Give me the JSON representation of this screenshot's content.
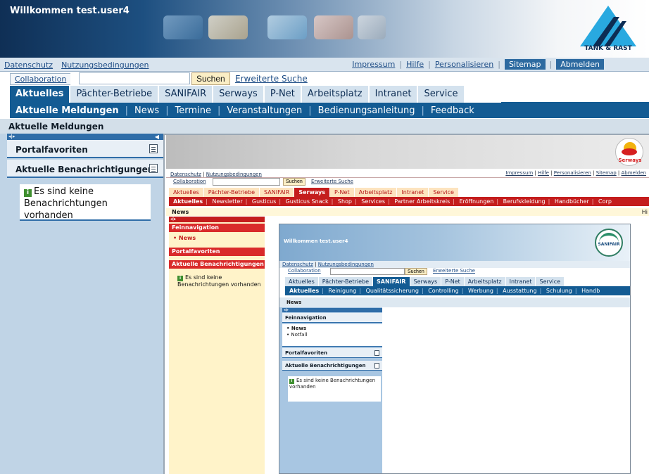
{
  "portal": {
    "welcome": "Willkommen test.user4",
    "logo_text": "TANK & RAST",
    "utility_left": [
      "Datenschutz",
      "Nutzungsbedingungen"
    ],
    "utility_right": [
      "Impressum",
      "Hilfe",
      "Personalisieren",
      "Sitemap",
      "Abmelden"
    ],
    "search_scope": "Collaboration",
    "search_value": "",
    "search_button": "Suchen",
    "advanced_search": "Erweiterte Suche",
    "tabs": [
      "Aktuelles",
      "Pächter-Betriebe",
      "SANIFAIR",
      "Serways",
      "P-Net",
      "Arbeitsplatz",
      "Intranet",
      "Service"
    ],
    "subnav": [
      "Aktuelle Meldungen",
      "News",
      "Termine",
      "Veranstaltungen",
      "Bedienungsanleitung",
      "Feedback"
    ],
    "page_title": "Aktuelle Meldungen",
    "panel_favorites": "Portalfavoriten",
    "panel_notifications": "Aktuelle Benachrichtigungen",
    "notification_text": "Es sind keine Benachrichtungen vorhanden"
  },
  "serways": {
    "logo_text": "Serways",
    "utility_left": [
      "Datenschutz",
      "Nutzungsbedingungen"
    ],
    "utility_right": [
      "Impressum",
      "Hilfe",
      "Personalisieren",
      "Sitemap",
      "Abmelden"
    ],
    "search_scope": "Collaboration",
    "search_button": "Suchen",
    "advanced_search": "Erweiterte Suche",
    "tabs": [
      "Aktuelles",
      "Pächter-Betriebe",
      "SANIFAIR",
      "Serways",
      "P-Net",
      "Arbeitsplatz",
      "Intranet",
      "Service"
    ],
    "subnav": [
      "Aktuelles",
      "Newsletter",
      "Gusticus",
      "Gusticus Snack",
      "Shop",
      "Services",
      "Partner Arbeitskreis",
      "Eröffnungen",
      "Berufskleidung",
      "Handbücher",
      "Corp"
    ],
    "page_title": "News",
    "right_fragment": "Hi",
    "nav_title": "Feinnavigation",
    "nav_item": "• News",
    "panel_favorites": "Portalfavoriten",
    "panel_notifications": "Aktuelle Benachrichtigungen",
    "notification_text": "Es sind keine Benachrichtungen vorhanden"
  },
  "sanifair": {
    "welcome": "Willkommen test.user4",
    "logo_text": "SANIFAIR",
    "utility_left": [
      "Datenschutz",
      "Nutzungsbedingungen"
    ],
    "search_scope": "Collaboration",
    "search_button": "Suchen",
    "advanced_search": "Erweiterte Suche",
    "tabs": [
      "Aktuelles",
      "Pächter-Betriebe",
      "SANIFAIR",
      "Serways",
      "P-Net",
      "Arbeitsplatz",
      "Intranet",
      "Service"
    ],
    "subnav": [
      "Aktuelles",
      "Reinigung",
      "Qualitätssicherung",
      "Controlling",
      "Werbung",
      "Ausstattung",
      "Schulung",
      "Handb"
    ],
    "page_title": "News",
    "nav_title": "Feinnavigation",
    "nav_items": [
      "• News",
      "• Notfall"
    ],
    "panel_favorites": "Portalfavoriten",
    "panel_notifications": "Aktuelle Benachrichtigungen",
    "notification_text": "Es sind keine Benachrichtungen vorhanden"
  },
  "icons": {
    "info": "info-icon",
    "panel_menu": "panel-menu-icon",
    "collapse": "collapse-arrow-icon"
  },
  "colors": {
    "portal_blue": "#135b93",
    "serways_red": "#c41d1d",
    "sanifair_green": "#2b8f6a"
  }
}
